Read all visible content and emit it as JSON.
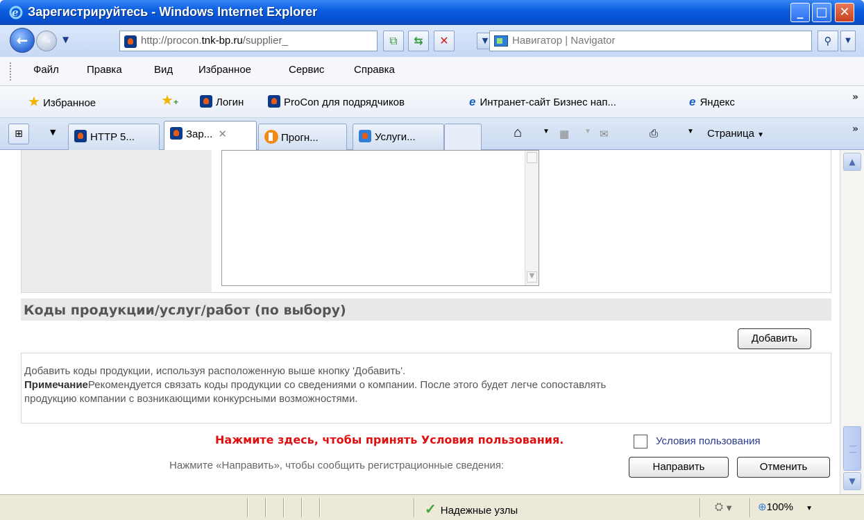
{
  "window": {
    "title": "Зарегистрируйтесь - Windows Internet Explorer",
    "controls": {
      "minimize": "_",
      "maximize": "□",
      "close": "✕"
    }
  },
  "address": {
    "url_prefix": "http://procon.",
    "url_domain": "tnk-bp.ru",
    "url_suffix": "/supplier_",
    "search_placeholder": "Навигатор | Navigator"
  },
  "menu": [
    "Файл",
    "Правка",
    "Вид",
    "Избранное",
    "Сервис",
    "Справка"
  ],
  "favorites_bar": {
    "favorites_label": "Избранное",
    "links": [
      "Логин",
      "ProCon для подрядчиков",
      "Интранет-сайт Бизнес нап...",
      "Яндекс"
    ]
  },
  "tabs": [
    "HTTP 5...",
    "Зар...",
    "Прогн...",
    "Услуги..."
  ],
  "command_bar": {
    "page_label": "Страница"
  },
  "section": {
    "title": "Коды продукции/услуг/работ (по выбору)",
    "add_button": "Добавить",
    "info_line1": "Добавить коды продукции, используя расположенную выше кнопку 'Добавить'.",
    "note_label": "Примечание",
    "note_text": "Рекомендуется связать коды продукции со сведениями о компании. После этого будет легче сопоставлять",
    "note_text2": "продукцию компании с возникающими конкурсными возможностями."
  },
  "terms": {
    "accept_text": "Нажмите здесь, чтобы принять Условия пользования.",
    "checkbox_label": "Условия пользования",
    "checked": false
  },
  "submit": {
    "hint": "Нажмите «Направить», чтобы сообщить регистрационные сведения:",
    "submit_button": "Направить",
    "cancel_button": "Отменить"
  },
  "statusbar": {
    "zone": "Надежные узлы",
    "zoom": "100%"
  },
  "colors": {
    "titlebar": "#0b5ee0",
    "accept_text": "#e01010",
    "section_header_bg": "#e8e8e8"
  }
}
